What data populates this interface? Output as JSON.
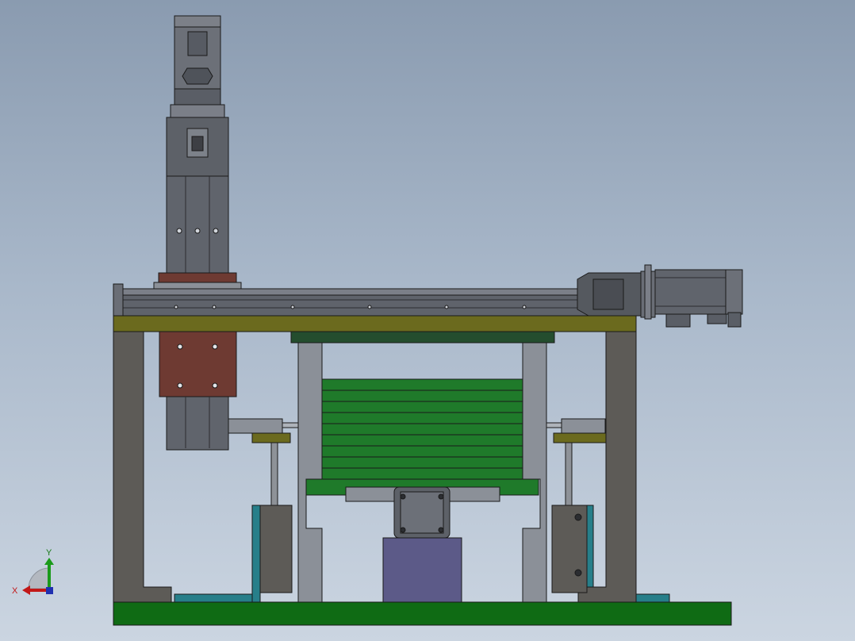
{
  "viewport": {
    "background_top": "#8a9bb0",
    "background_bottom": "#cbd5e1"
  },
  "colors": {
    "frame_gray": "#5d5b57",
    "steel_light": "#8b9098",
    "steel_dark": "#3d3f44",
    "olive_plate": "#6b6a1e",
    "green_base": "#0f6b14",
    "green_stack": "#1f7a2a",
    "teal": "#277f8a",
    "brown_block": "#6e3a32",
    "purple_block": "#5c5a88",
    "dark_green_bar": "#244d2e",
    "outline": "#1a1a1a"
  },
  "triad": {
    "x_label": "X",
    "y_label": "Y",
    "x_color": "#c21818",
    "y_color": "#1a9a1a",
    "z_color": "#2030b0"
  },
  "icons": {
    "triad": "coordinate-triad-icon",
    "rotation": "view-rotation-arc-icon"
  }
}
